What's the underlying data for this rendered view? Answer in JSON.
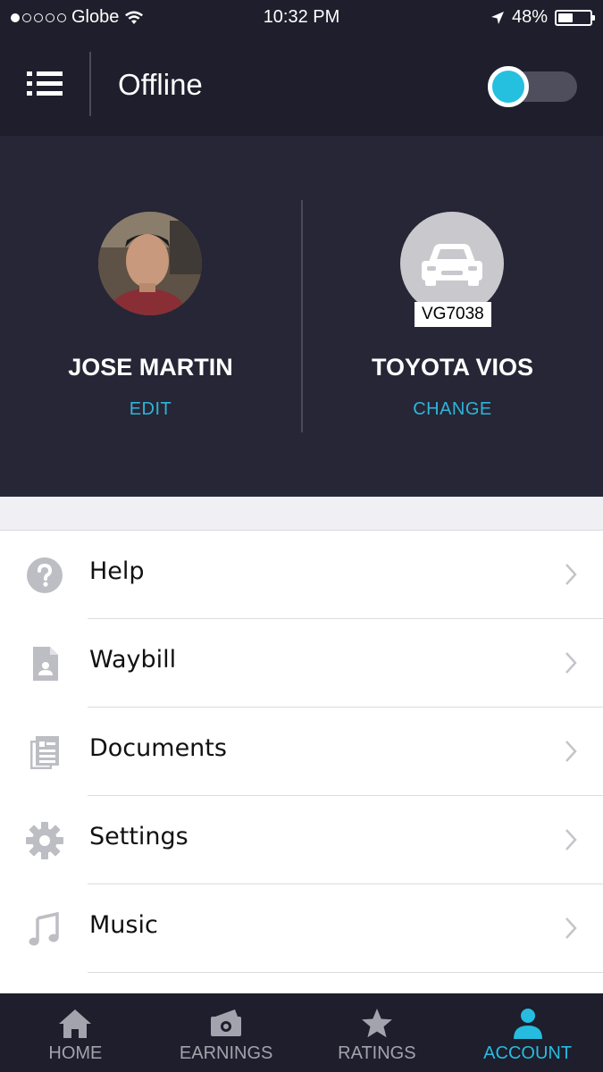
{
  "status_bar": {
    "carrier": "Globe",
    "time": "10:32 PM",
    "battery": "48%",
    "battery_level": 0.48,
    "signal_bars": 1
  },
  "header": {
    "menu_icon": "list-menu-icon",
    "status_title": "Offline",
    "toggle_on": false,
    "accent_color": "#25c0df"
  },
  "profile": {
    "driver_name": "JOSE MARTIN",
    "driver_action": "EDIT",
    "vehicle_name": "TOYOTA VIOS",
    "vehicle_action": "CHANGE",
    "plate": "VG7038"
  },
  "menu": {
    "items": [
      {
        "label": "Help",
        "icon": "help-icon"
      },
      {
        "label": "Waybill",
        "icon": "waybill-icon"
      },
      {
        "label": "Documents",
        "icon": "documents-icon"
      },
      {
        "label": "Settings",
        "icon": "gear-icon"
      },
      {
        "label": "Music",
        "icon": "music-icon"
      }
    ]
  },
  "tabs": {
    "items": [
      {
        "label": "HOME",
        "icon": "home-icon"
      },
      {
        "label": "EARNINGS",
        "icon": "earnings-icon"
      },
      {
        "label": "RATINGS",
        "icon": "star-icon"
      },
      {
        "label": "ACCOUNT",
        "icon": "person-icon",
        "active": true
      }
    ],
    "active_color": "#26bce0"
  }
}
